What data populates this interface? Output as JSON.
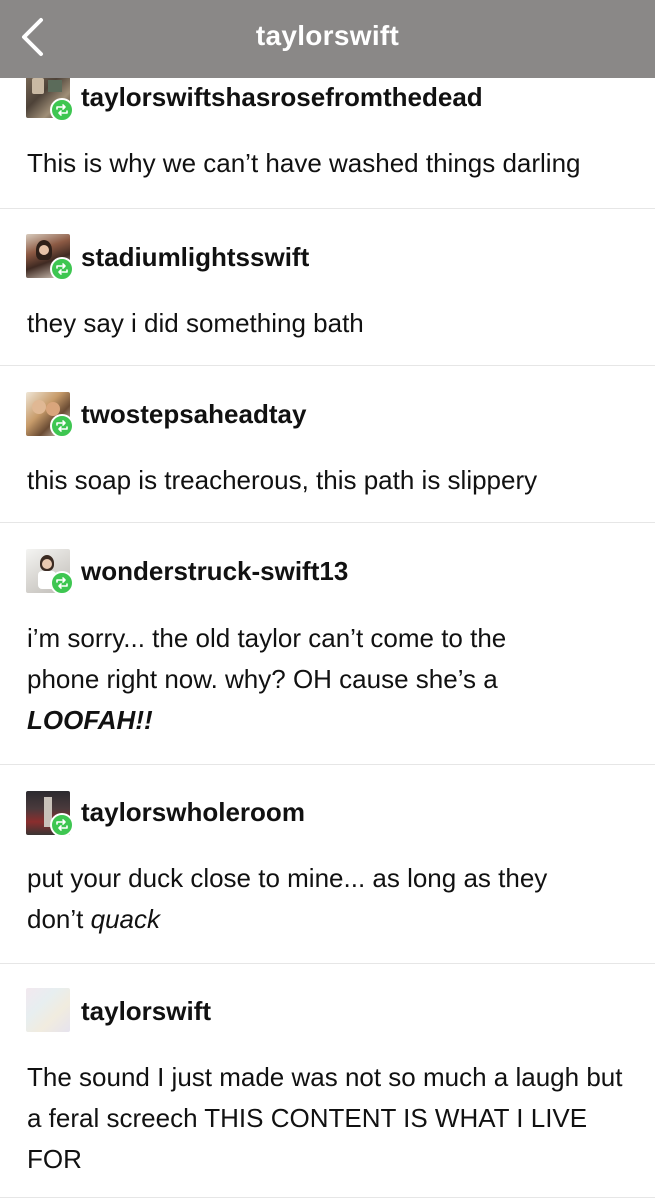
{
  "header": {
    "title": "taylorswift"
  },
  "posts": [
    {
      "username": "taylorswiftshasrosefromthedead",
      "text": "This is why we can’t have washed things darling"
    },
    {
      "username": "stadiumlightsswift",
      "text": "they say i did something bath"
    },
    {
      "username": "twostepsaheadtay",
      "text": "this soap is treacherous, this path is slippery"
    },
    {
      "username": "wonderstruck-swift13",
      "text_line1": "i’m sorry... the old taylor can’t come to the",
      "text_line2": "phone right now. why? OH cause she’s a",
      "text_line3": "LOOFAH!!"
    },
    {
      "username": "taylorswholeroom",
      "text_line1": "put your duck close to mine... as long as they",
      "text_line2_prefix": "don’t ",
      "text_line2_em": "quack"
    },
    {
      "username": "taylorswift",
      "text": "The sound I just made was not so much a laugh but a feral screech THIS CONTENT IS WHAT I LIVE FOR"
    }
  ],
  "icons": {
    "back": "chevron-left-icon",
    "reblog": "reblog-icon"
  },
  "colors": {
    "header_bg": "#8a8887",
    "reblog_green": "#3ec651"
  }
}
